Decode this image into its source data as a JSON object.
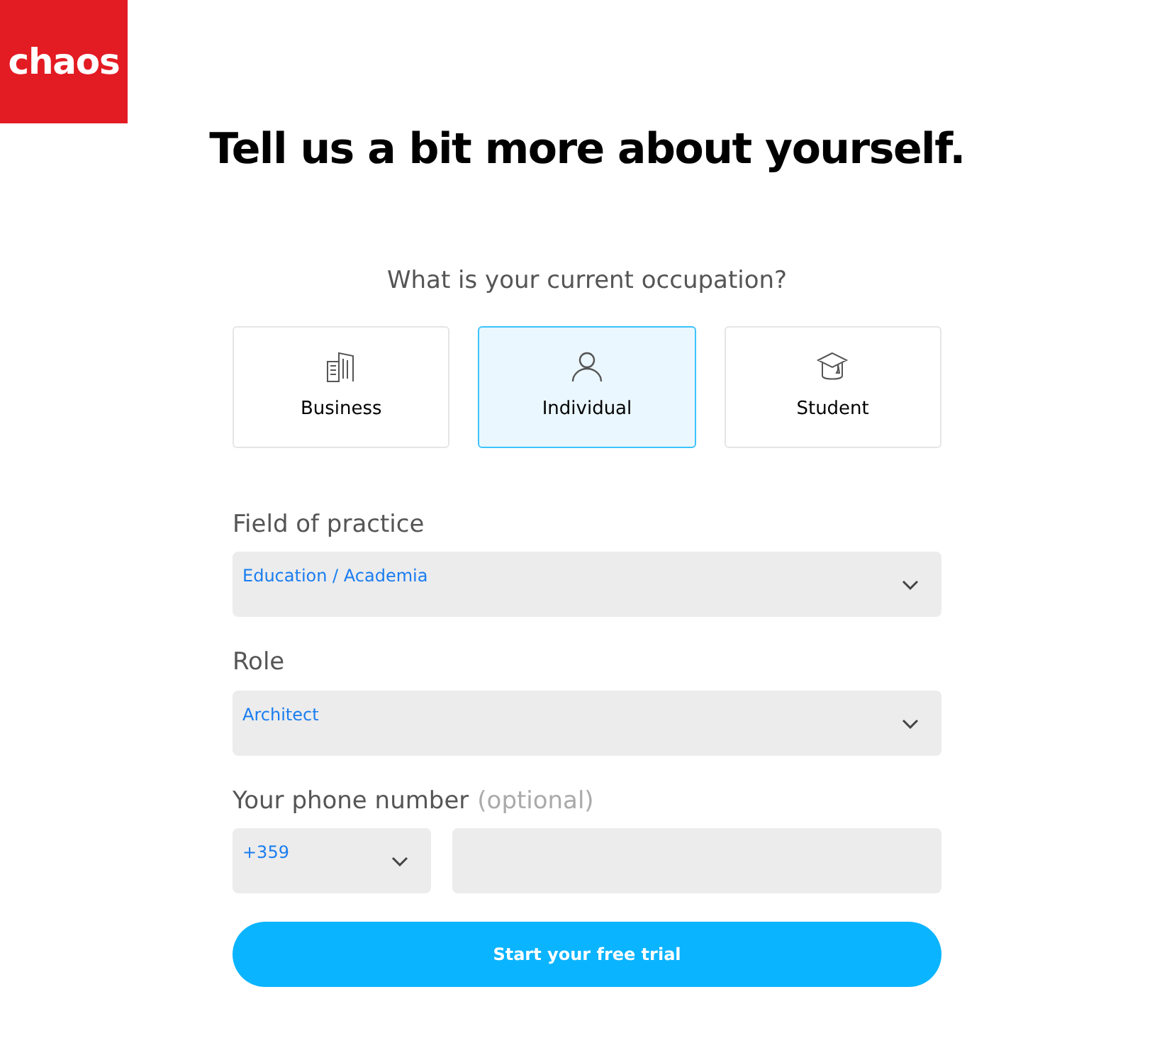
{
  "logo": {
    "text": "chaos"
  },
  "heading": "Tell us a bit more about yourself.",
  "occupation": {
    "question": "What is your current occupation?",
    "options": [
      {
        "kind": "business",
        "label": "Business",
        "selected": false
      },
      {
        "kind": "individual",
        "label": "Individual",
        "selected": true
      },
      {
        "kind": "student",
        "label": "Student",
        "selected": false
      }
    ]
  },
  "field_of_practice": {
    "label": "Field of practice",
    "value": "Education / Academia"
  },
  "role": {
    "label": "Role",
    "value": "Architect"
  },
  "phone": {
    "label": "Your phone number",
    "note": "(optional)",
    "country_code": "+359"
  },
  "submit_button": "Start your free trial"
}
